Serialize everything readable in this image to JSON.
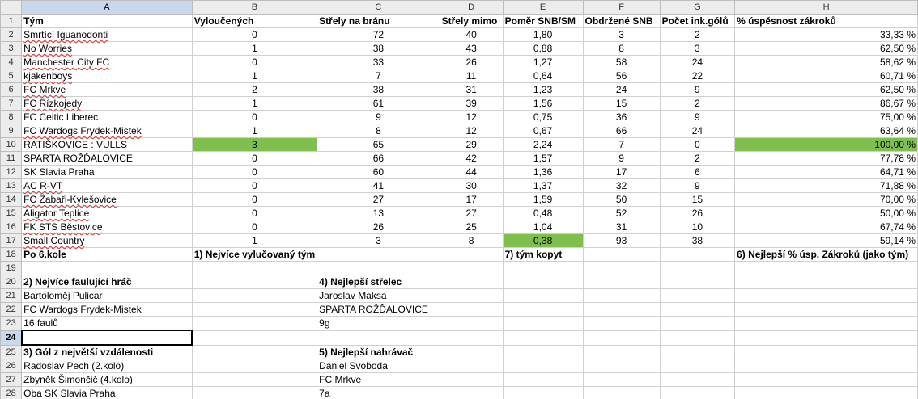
{
  "columns": [
    "A",
    "B",
    "C",
    "D",
    "E",
    "F",
    "G",
    "H"
  ],
  "headers": [
    "Tým",
    "Vyloučených",
    "Střely na bránu",
    "Střely mimo",
    "Poměr SNB/SM",
    "Obdržené SNB",
    "Počet ink.gólů",
    "% úspěsnost zákroků"
  ],
  "teams": [
    {
      "row": "2",
      "name": "Smrtící Iguanodonti",
      "b": "0",
      "c": "72",
      "d": "40",
      "e": "1,80",
      "f": "3",
      "g": "2",
      "h": "33,33 %"
    },
    {
      "row": "3",
      "name": "No Worries",
      "b": "1",
      "c": "38",
      "d": "43",
      "e": "0,88",
      "f": "8",
      "g": "3",
      "h": "62,50 %"
    },
    {
      "row": "4",
      "name": "Manchester City FC",
      "b": "0",
      "c": "33",
      "d": "26",
      "e": "1,27",
      "f": "58",
      "g": "24",
      "h": "58,62 %"
    },
    {
      "row": "5",
      "name": "kjakenboys",
      "b": "1",
      "c": "7",
      "d": "11",
      "e": "0,64",
      "f": "56",
      "g": "22",
      "h": "60,71 %"
    },
    {
      "row": "6",
      "name": "FC Mrkve",
      "b": "2",
      "c": "38",
      "d": "31",
      "e": "1,23",
      "f": "24",
      "g": "9",
      "h": "62,50 %"
    },
    {
      "row": "7",
      "name": "FC Řízkojedy",
      "b": "1",
      "c": "61",
      "d": "39",
      "e": "1,56",
      "f": "15",
      "g": "2",
      "h": "86,67 %"
    },
    {
      "row": "8",
      "name": "FC Celtic Liberec",
      "b": "0",
      "c": "9",
      "d": "12",
      "e": "0,75",
      "f": "36",
      "g": "9",
      "h": "75,00 %"
    },
    {
      "row": "9",
      "name": "FC Wardogs Frydek-Mistek",
      "b": "1",
      "c": "8",
      "d": "12",
      "e": "0,67",
      "f": "66",
      "g": "24",
      "h": "63,64 %"
    },
    {
      "row": "10",
      "name": "RATIŠKOVICE : VULLS",
      "b": "3",
      "c": "65",
      "d": "29",
      "e": "2,24",
      "f": "7",
      "g": "0",
      "h": "100,00 %"
    },
    {
      "row": "11",
      "name": "SPARTA ROŽĎALOVICE",
      "b": "0",
      "c": "66",
      "d": "42",
      "e": "1,57",
      "f": "9",
      "g": "2",
      "h": "77,78 %"
    },
    {
      "row": "12",
      "name": "SK Slavia Praha",
      "b": "0",
      "c": "60",
      "d": "44",
      "e": "1,36",
      "f": "17",
      "g": "6",
      "h": "64,71 %"
    },
    {
      "row": "13",
      "name": "AC R-VT",
      "b": "0",
      "c": "41",
      "d": "30",
      "e": "1,37",
      "f": "32",
      "g": "9",
      "h": "71,88 %"
    },
    {
      "row": "14",
      "name": "FC Žabaři-Kylešovice",
      "b": "0",
      "c": "27",
      "d": "17",
      "e": "1,59",
      "f": "50",
      "g": "15",
      "h": "70,00 %"
    },
    {
      "row": "15",
      "name": "Aligator Teplice",
      "b": "0",
      "c": "13",
      "d": "27",
      "e": "0,48",
      "f": "52",
      "g": "26",
      "h": "50,00 %"
    },
    {
      "row": "16",
      "name": "FK STS Běstovice",
      "b": "0",
      "c": "26",
      "d": "25",
      "e": "1,04",
      "f": "31",
      "g": "10",
      "h": "67,74 %"
    },
    {
      "row": "17",
      "name": "Small Country",
      "b": "1",
      "c": "3",
      "d": "8",
      "e": "0,38",
      "f": "93",
      "g": "38",
      "h": "59,14 %"
    }
  ],
  "row18": {
    "a": "Po 6.kole",
    "b": "1) Nejvíce vylučovaný tým",
    "e": "7) tým kopyt",
    "h": "6) Nejlepší % úsp. Zákroků (jako tým)"
  },
  "row20": {
    "a": "2) Nejvíce faulující hráč",
    "c": "4) Nejlepší střelec"
  },
  "row21": {
    "a": "Bartoloměj Pulicar",
    "c": "Jaroslav Maksa"
  },
  "row22": {
    "a": "FC Wardogs Frydek-Mistek",
    "c": "SPARTA ROŽĎALOVICE"
  },
  "row23": {
    "a": "16 faulů",
    "c": "9g"
  },
  "row25": {
    "a": "3) Gól z největší vzdálenosti",
    "c": "5) Nejlepší nahrávač"
  },
  "row26": {
    "a": "Radoslav Pech (2.kolo)",
    "c": "Daniel Svoboda"
  },
  "row27": {
    "a": "Zbyněk Šimončič (4.kolo)",
    "c": "FC Mrkve"
  },
  "row28": {
    "a": "Oba SK Slavia Praha",
    "c": "7a"
  },
  "rownums": [
    "1",
    "18",
    "19",
    "20",
    "21",
    "22",
    "23",
    "24",
    "25",
    "26",
    "27",
    "28"
  ],
  "colors": {
    "highlight": "#7fbf4d",
    "selection": "#c8d9ee",
    "spellcheck": "#d33"
  }
}
